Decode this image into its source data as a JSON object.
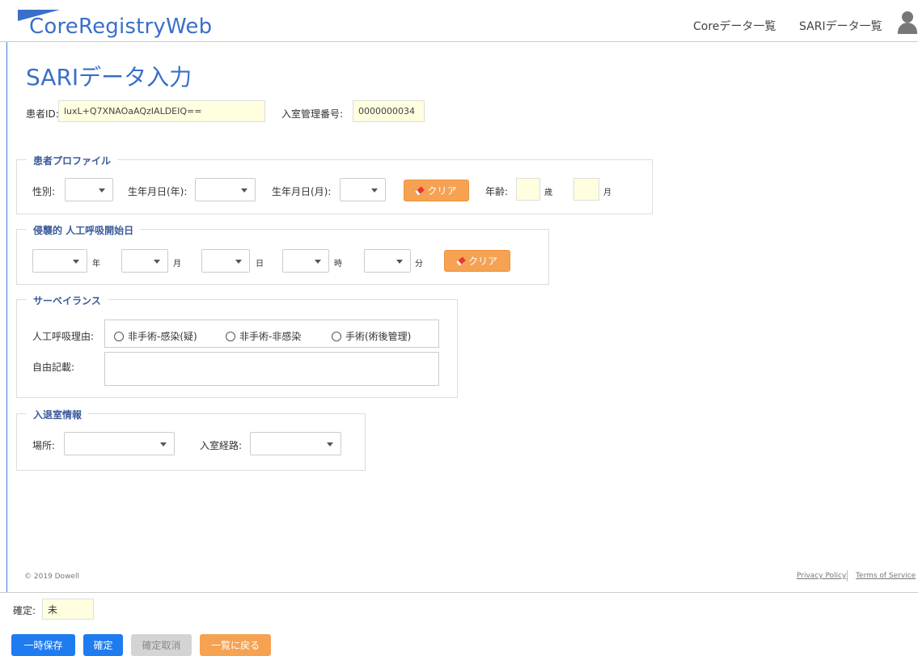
{
  "app": {
    "title": "CoreRegistryWeb"
  },
  "nav": {
    "core_list": "Coreデータ一覧",
    "sari_list": "SARIデータ一覧"
  },
  "page": {
    "title": "SARIデータ入力"
  },
  "patient": {
    "id_label": "患者ID:",
    "id_value": "luxL+Q7XNAOaAQzIALDEIQ==",
    "admission_label": "入室管理番号:",
    "admission_value": "0000000034"
  },
  "profile": {
    "legend": "患者プロファイル",
    "sex_label": "性別:",
    "birth_year_label": "生年月日(年):",
    "birth_month_label": "生年月日(月):",
    "clear_label": "クリア",
    "age_label": "年齢:",
    "age_years_unit": "歳",
    "age_months_unit": "月"
  },
  "ventilation": {
    "legend": "侵襲的 人工呼吸開始日",
    "year_unit": "年",
    "month_unit": "月",
    "day_unit": "日",
    "hour_unit": "時",
    "minute_unit": "分",
    "clear_label": "クリア"
  },
  "surveillance": {
    "legend": "サーベイランス",
    "reason_label": "人工呼吸理由:",
    "options": [
      "非手術-感染(疑)",
      "非手術-非感染",
      "手術(術後管理)"
    ],
    "free_text_label": "自由記載:"
  },
  "admission_info": {
    "legend": "入退室情報",
    "place_label": "場所:",
    "route_label": "入室経路:"
  },
  "footer": {
    "copyright": "© 2019 Dowell",
    "privacy": "Privacy Policy",
    "terms": "Terms of Service"
  },
  "confirm": {
    "label": "確定:",
    "value": "未"
  },
  "actions": {
    "temp_save": "一時保存",
    "confirm": "確定",
    "cancel_confirm": "確定取消",
    "back_to_list": "一覧に戻る"
  },
  "colors": {
    "brand": "#3a6fc9",
    "orange": "#f5a253",
    "blue_btn": "#1e7cf0",
    "input_yellow": "#ffffe0"
  }
}
